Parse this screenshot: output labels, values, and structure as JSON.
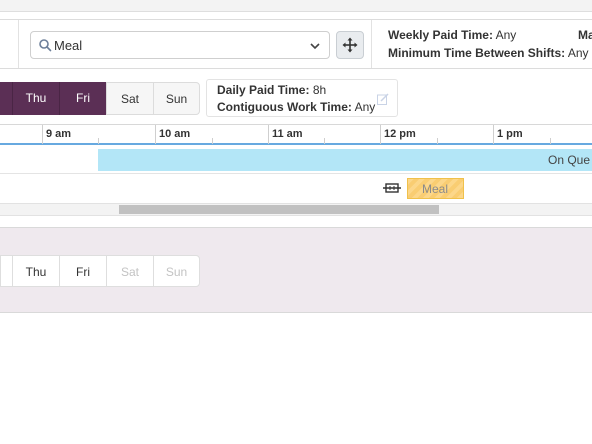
{
  "toolbar": {
    "activity_select": {
      "value": "Meal"
    },
    "summary": {
      "weekly_paid_label": "Weekly Paid Time:",
      "weekly_paid_value": "Any",
      "min_between_label": "Minimum Time Between Shifts:",
      "min_between_value": "Any",
      "cut_label": "Ma"
    }
  },
  "days": [
    {
      "label": "",
      "active": true
    },
    {
      "label": "Thu",
      "active": true
    },
    {
      "label": "Fri",
      "active": true
    },
    {
      "label": "Sat",
      "active": false
    },
    {
      "label": "Sun",
      "active": false
    }
  ],
  "day_info": {
    "daily_paid_label": "Daily Paid Time:",
    "daily_paid_value": "8h",
    "contiguous_label": "Contiguous Work Time:",
    "contiguous_value": "Any"
  },
  "timeline": {
    "hours": [
      "9 am",
      "10 am",
      "11 am",
      "12 pm",
      "1 pm"
    ],
    "on_queue_label": "On Que",
    "meal_label": "Meal"
  },
  "panel2": {
    "days": [
      {
        "label": "",
        "enabled": true
      },
      {
        "label": "Thu",
        "enabled": true
      },
      {
        "label": "Fri",
        "enabled": true
      },
      {
        "label": "Sat",
        "enabled": false
      },
      {
        "label": "Sun",
        "enabled": false
      }
    ]
  },
  "colors": {
    "active_day": "#5b2f55",
    "on_queue": "#b3e6f7",
    "meal": "#fcd78a",
    "timeline_accent": "#67a9e0",
    "panel_bg": "#efe9ee"
  }
}
